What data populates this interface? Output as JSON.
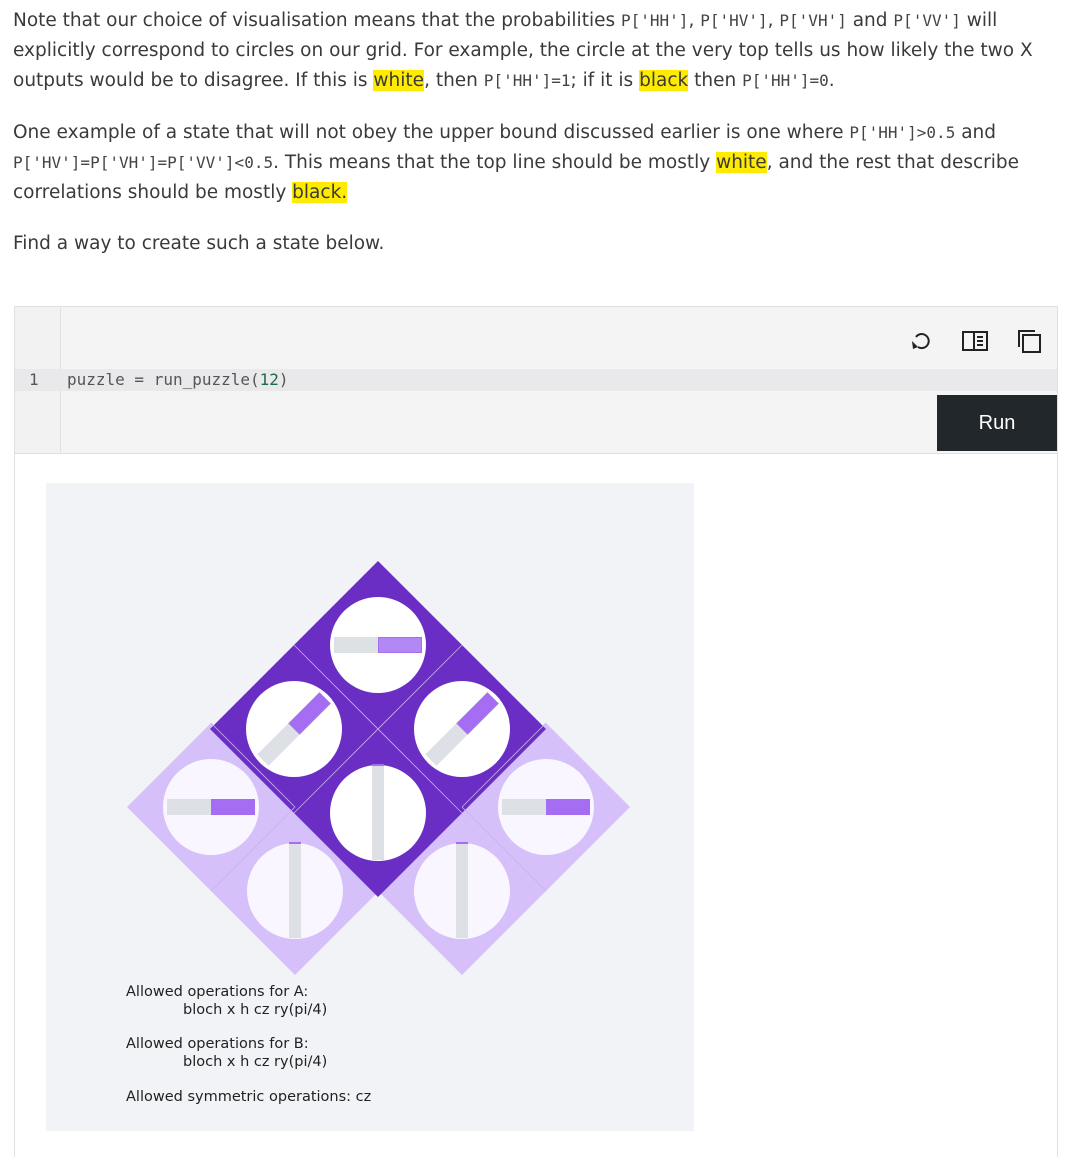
{
  "paragraph1": {
    "t1": "Note that our choice of visualisation means that the probabilities ",
    "c1": "P['HH']",
    "t2": ", ",
    "c2": "P['HV']",
    "t3": ", ",
    "c3": "P['VH']",
    "t4": " and ",
    "c4": "P['VV']",
    "t5": " will explicitly correspond to circles on our grid. For example, the circle at the very top tells us how likely the two X outputs would be to disagree. If this is ",
    "h1": "white",
    "t6": ", then ",
    "c5": "P['HH']=1",
    "t7": "; if it is ",
    "h2": "black",
    "t8": " then ",
    "c6": "P['HH']=0",
    "t9": "."
  },
  "paragraph2": {
    "t1": "One example of a state that will not obey the upper bound discussed earlier is one where ",
    "c1": "P['HH']>0.5",
    "t2": " and ",
    "c2": "P['HV']=P['VH']=P['VV']<0.5",
    "t3": ". This means that the top line should be mostly ",
    "h1": "white",
    "t4": ", and the rest that describe correlations should be mostly ",
    "h2": "black."
  },
  "paragraph3": "Find a way to create such a state below.",
  "code_cell": {
    "line_number": "1",
    "code_prefix": "puzzle = run_puzzle(",
    "code_arg": "12",
    "code_suffix": ")",
    "run_label": "Run",
    "icons": [
      "undo-icon",
      "split-view-icon",
      "copy-icon"
    ]
  },
  "figure": {
    "colors": {
      "dark": "#6a2ec4",
      "light": "#d5c0fa",
      "background": "#f2f3f7",
      "bar_fill": "#a56ef2",
      "bar_track": "#dde0e4"
    },
    "ops_a_title": "Allowed operations for A:",
    "ops_a_list": "bloch   x   h   cz   ry(pi/4)",
    "ops_b_title": "Allowed operations for B:",
    "ops_b_list": "bloch   x   h   cz   ry(pi/4)",
    "ops_sym": "Allowed symmetric operations:  cz"
  }
}
